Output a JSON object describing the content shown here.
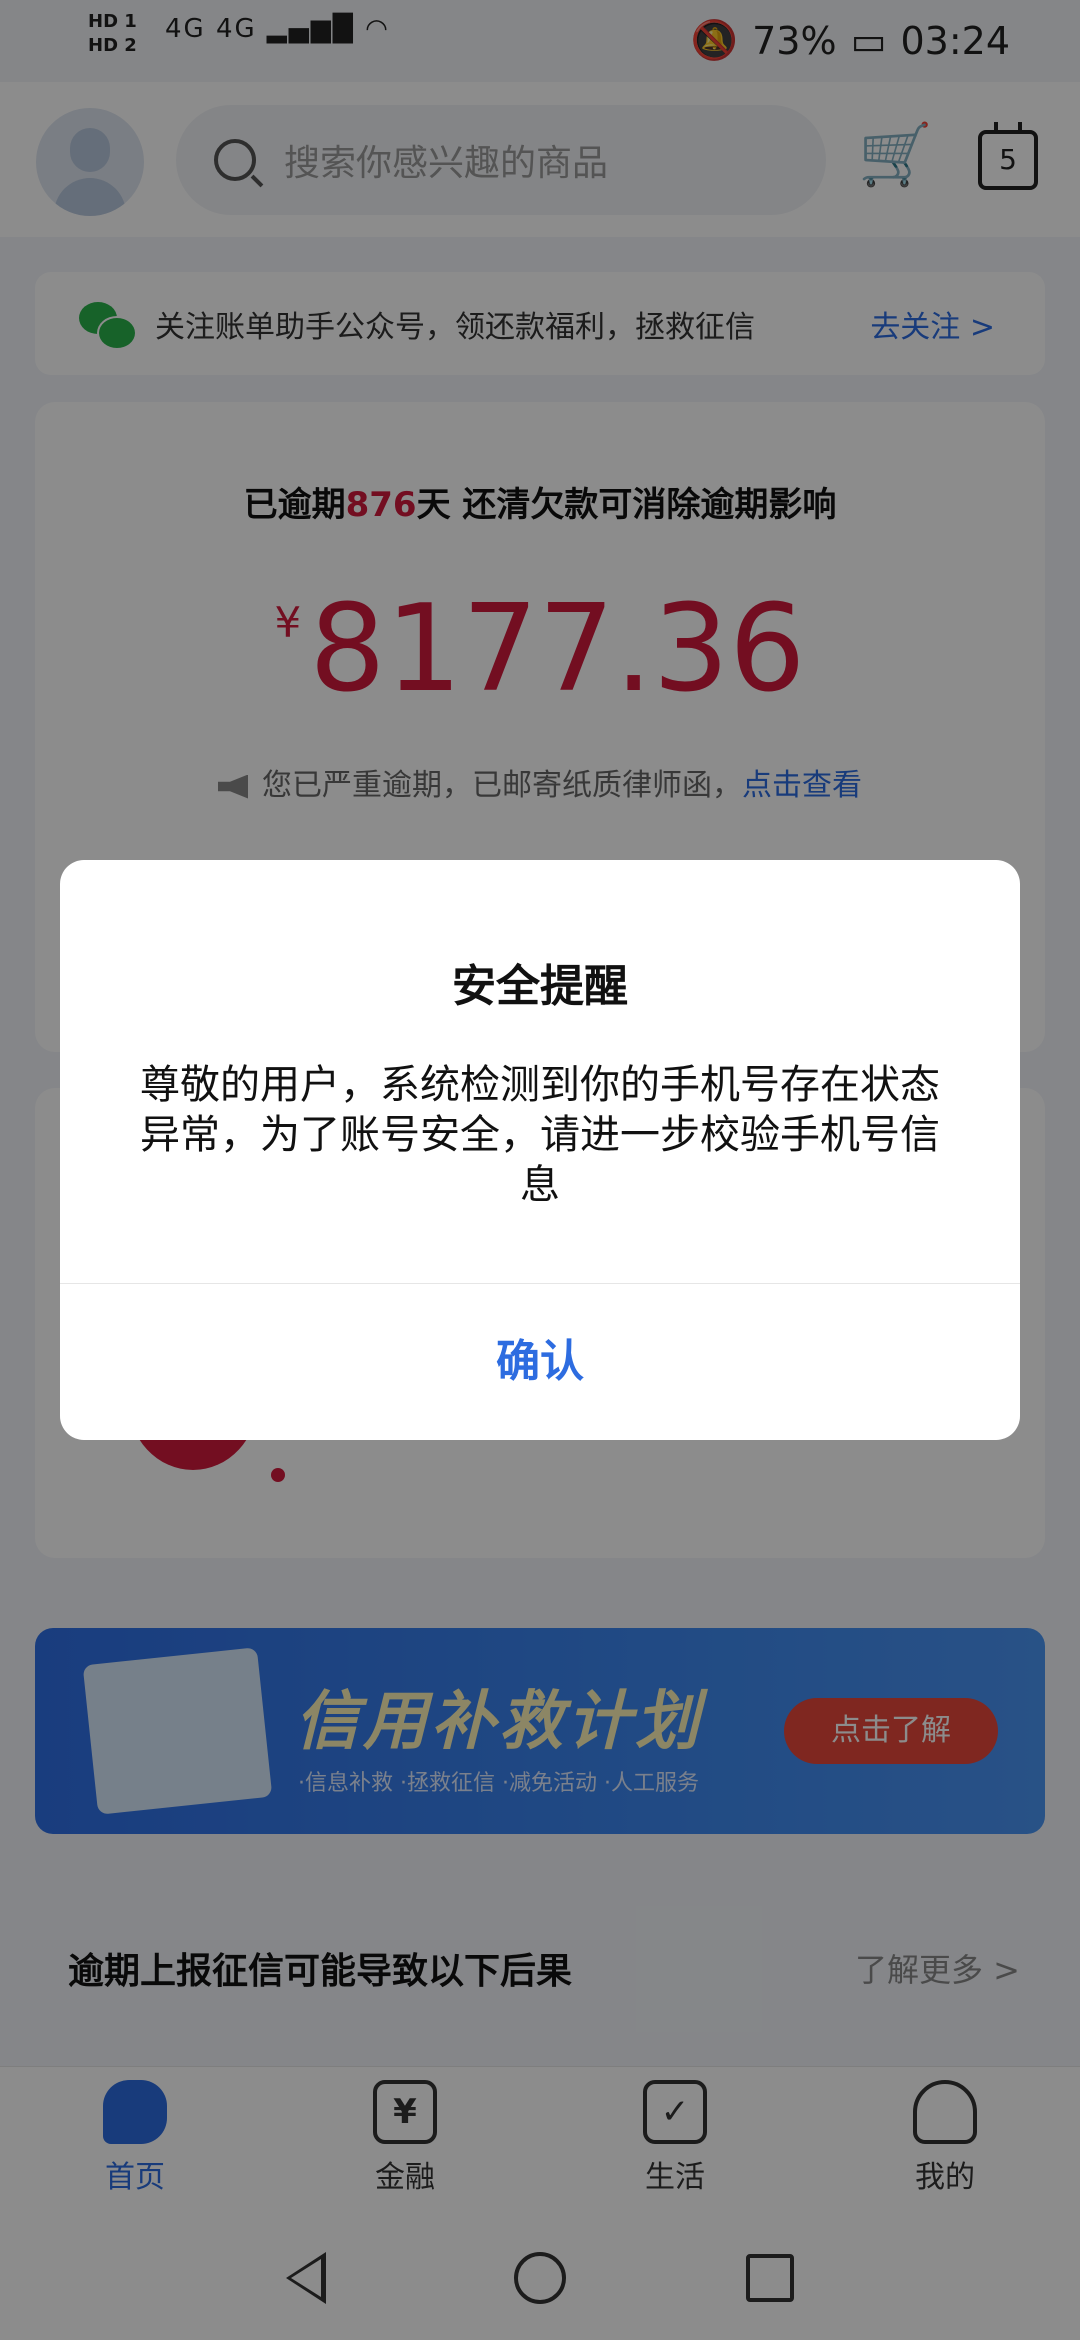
{
  "status_bar": {
    "hd1": "HD 1",
    "hd2": "HD 2",
    "signal": "4G 4G",
    "battery": "73%",
    "time": "03:24"
  },
  "header": {
    "search_placeholder": "搜索你感兴趣的商品",
    "calendar_day": "5"
  },
  "follow_bar": {
    "text": "关注账单助手公众号，领还款福利，拯救征信",
    "link": "去关注 >"
  },
  "overdue": {
    "prefix": "已逾期",
    "days": "876",
    "suffix": "天 还清欠款可消除逾期影响",
    "currency": "¥",
    "amount": "8177.36",
    "notice": "您已严重逾期，已邮寄纸质律师函，",
    "notice_link": "点击查看"
  },
  "banner": {
    "title": "信用补救计划",
    "subtitle": "·信息补救 ·拯救征信 ·减免活动 ·人工服务",
    "button": "点击了解"
  },
  "section": {
    "title": "逾期上报征信可能导致以下后果",
    "more": "了解更多 >"
  },
  "bottom_nav": {
    "items": [
      {
        "label": "首页"
      },
      {
        "label": "金融"
      },
      {
        "label": "生活"
      },
      {
        "label": "我的"
      }
    ],
    "finance_glyph": "¥"
  },
  "dialog": {
    "title": "安全提醒",
    "message": "尊敬的用户，系统检测到你的手机号存在状态异常，为了账号安全，请进一步校验手机号信息",
    "confirm": "确认"
  },
  "colors": {
    "accent": "#2d6ce0",
    "danger": "#d11a3c",
    "overlay": "rgba(0,0,0,0.45)"
  }
}
